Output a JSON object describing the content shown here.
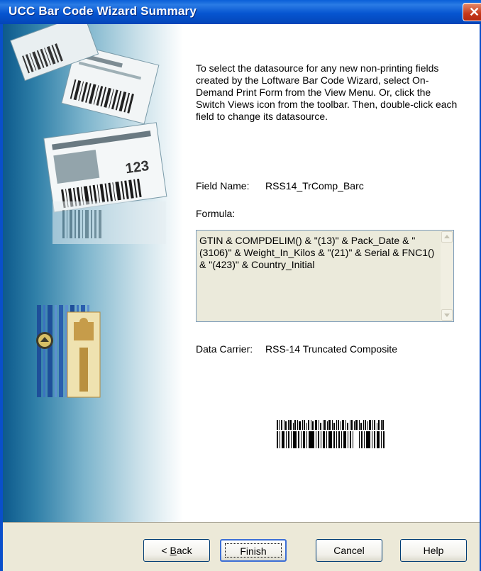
{
  "window": {
    "title": "UCC Bar Code Wizard Summary",
    "close_icon": "close-icon"
  },
  "description": "To select the datasource for any new non-printing fields created  by the Loftware Bar Code Wizard, select On-Demand Print Form from the View Menu. Or, click the Switch Views icon from the toolbar. Then, double-click each field to change its datasource.",
  "field": {
    "label": "Field Name:",
    "value": "RSS14_TrComp_Barc"
  },
  "formula": {
    "label": "Formula:",
    "text": "GTIN & COMPDELIM() & \"(13)\" & Pack_Date & \"(3106)\" & Weight_In_Kilos & \"(21)\" & Serial & FNC1() & \"(423)\" & Country_Initial"
  },
  "carrier": {
    "label": "Data Carrier:",
    "value": "RSS-14 Truncated Composite"
  },
  "side_graphic": {
    "labels_text": "123"
  },
  "buttons": {
    "back_prefix": "< ",
    "back_key": "B",
    "back_rest": "ack",
    "finish": "Finish",
    "cancel": "Cancel",
    "help": "Help"
  },
  "colors": {
    "titlebar": "#0555d1",
    "accent": "#3c6fd6",
    "dialog_bg": "#ece9d8"
  }
}
